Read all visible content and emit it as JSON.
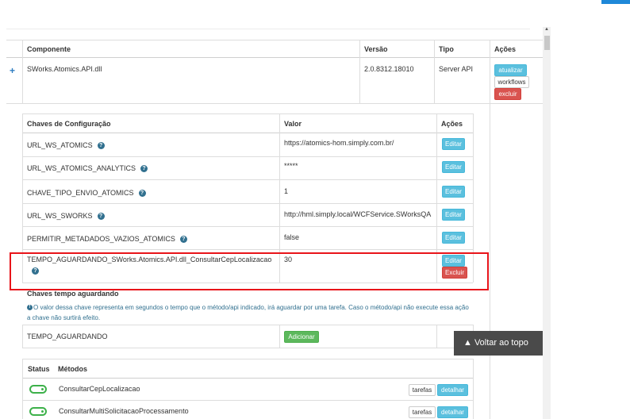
{
  "components_table": {
    "headers": {
      "component": "Componente",
      "version": "Versão",
      "type": "Tipo",
      "actions": "Ações"
    },
    "row": {
      "expand_icon": "plus-icon",
      "component": "SWorks.Atomics.API.dll",
      "version": "2.0.8312.18010",
      "type": "Server API",
      "actions": {
        "update": "atualizar",
        "workflows": "workflows",
        "delete": "excluir"
      }
    }
  },
  "config_table": {
    "headers": {
      "key": "Chaves de Configuração",
      "value": "Valor",
      "actions": "Ações"
    },
    "rows": [
      {
        "key": "URL_WS_ATOMICS",
        "value": "https://atomics-hom.simply.com.br/",
        "edit": "Editar"
      },
      {
        "key": "URL_WS_ATOMICS_ANALYTICS",
        "value": "*****",
        "edit": "Editar"
      },
      {
        "key": "CHAVE_TIPO_ENVIO_ATOMICS",
        "value": "1",
        "edit": "Editar"
      },
      {
        "key": "URL_WS_SWORKS",
        "value": "http://hml.simply.local/WCFService.SWorksQA",
        "edit": "Editar"
      },
      {
        "key": "PERMITIR_METADADOS_VAZIOS_ATOMICS",
        "value": "false",
        "edit": "Editar"
      },
      {
        "key": "TEMPO_AGUARDANDO_SWorks.Atomics.API.dll_ConsultarCepLocalizacao",
        "value": "30",
        "edit": "Editar",
        "delete": "Excluir"
      }
    ],
    "help_icon": "question-circle-icon"
  },
  "wait_section": {
    "title": "Chaves tempo aguardando",
    "note": "O valor dessa chave representa em segundos o tempo que o método/api indicado, irá aguardar por uma tarefa. Caso o método/api não execute essa ação a chave não surtirá efeito.",
    "row": {
      "key": "TEMPO_AGUARDANDO",
      "add": "Adicionar"
    }
  },
  "methods_table": {
    "headers": {
      "status": "Status",
      "methods": "Métodos"
    },
    "rows": [
      {
        "name": "ConsultarCepLocalizacao",
        "tasks": "tarefas",
        "detail": "detalhar",
        "enabled": true
      },
      {
        "name": "ConsultarMultiSolicitacaoProcessamento",
        "tasks": "tarefas",
        "detail": "detalhar",
        "enabled": true
      }
    ]
  },
  "back_to_top": "Voltar ao topo",
  "colors": {
    "highlight": "#e8141a",
    "info": "#5bc0de",
    "danger": "#d9534f",
    "success": "#5cb85c",
    "primary": "#1e88d8"
  }
}
